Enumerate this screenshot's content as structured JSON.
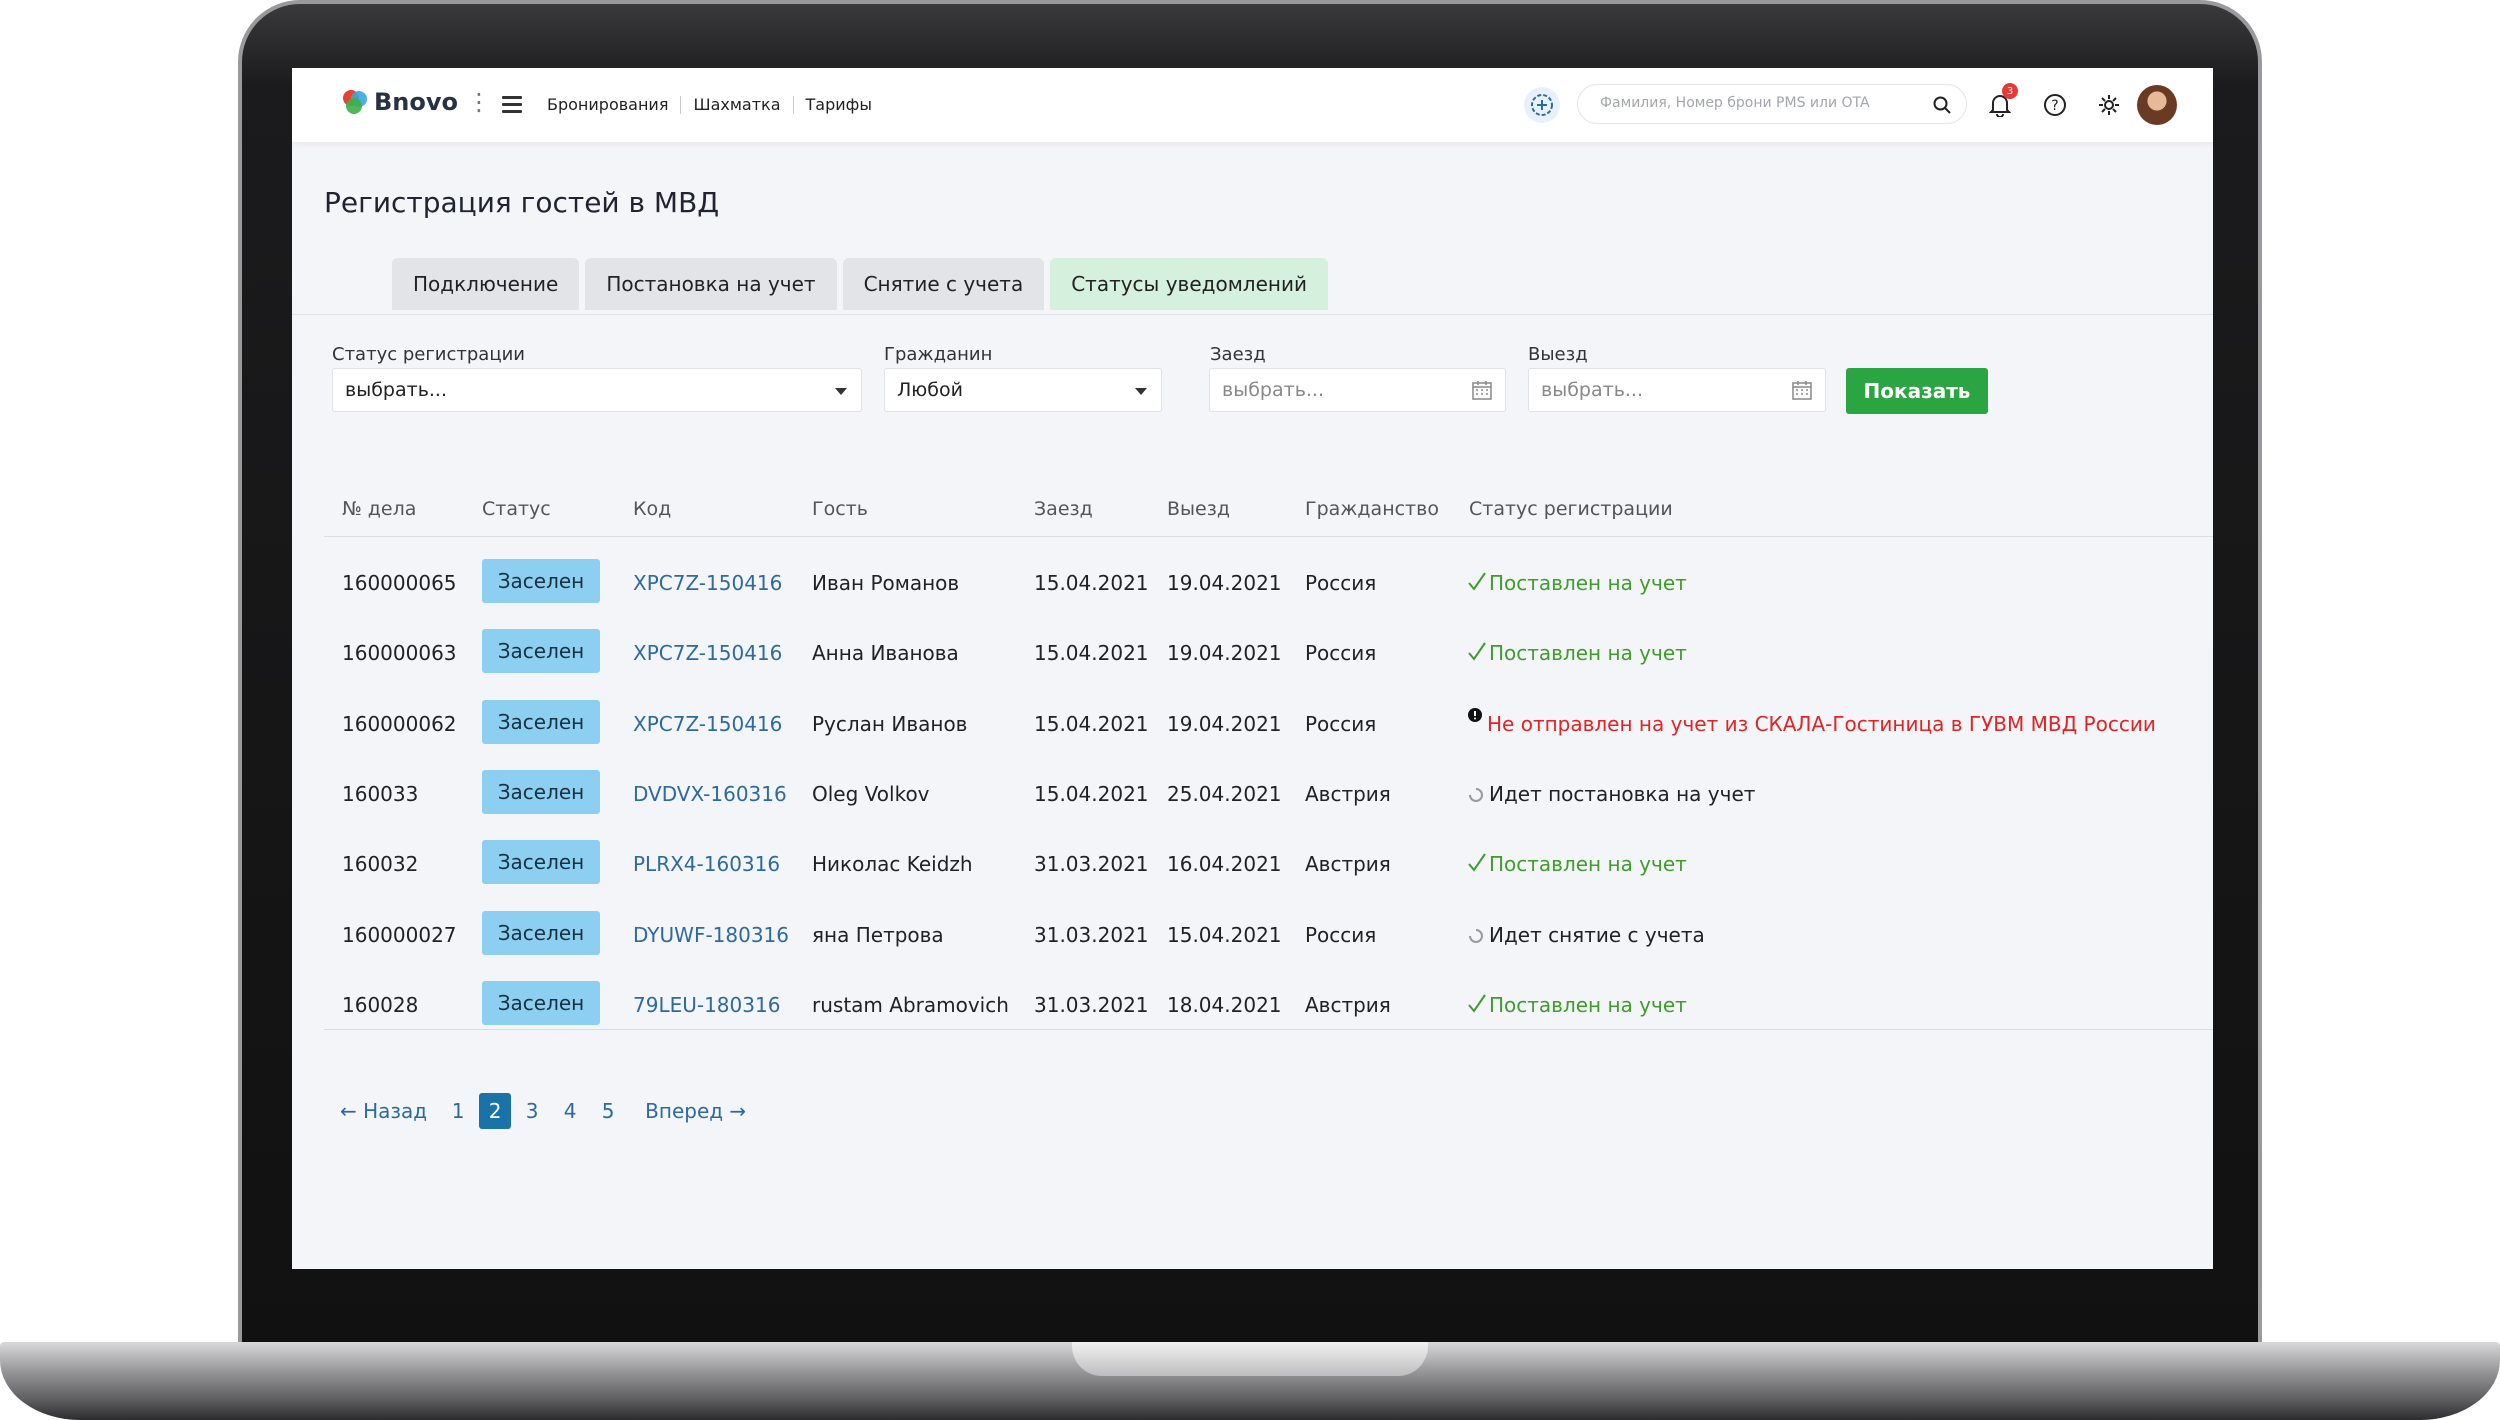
{
  "app": {
    "brand": "Bnovo",
    "nav": [
      "Бронирования",
      "Шахматка",
      "Тарифы"
    ],
    "search_placeholder": "Фамилия, Номер брони PMS или OTA",
    "notification_count": "3"
  },
  "page": {
    "title": "Регистрация гостей в МВД",
    "tabs": [
      "Подключение",
      "Постановка на учет",
      "Снятие с учета",
      "Статусы уведомлений"
    ],
    "active_tab": "Статусы уведомлений"
  },
  "filters": {
    "reg_status_label": "Статус регистрации",
    "reg_status_value": "выбрать...",
    "citizen_label": "Гражданин",
    "citizen_value": "Любой",
    "checkin_label": "Заезд",
    "checkin_placeholder": "выбрать...",
    "checkout_label": "Выезд",
    "checkout_placeholder": "выбрать...",
    "show_button": "Показать"
  },
  "table": {
    "headers": [
      "№ дела",
      "Статус",
      "Код",
      "Гость",
      "Заезд",
      "Выезд",
      "Гражданство",
      "Статус регистрации"
    ],
    "rows": [
      {
        "case": "160000065",
        "status": "Заселен",
        "code": "XPC7Z-150416",
        "guest": "Иван Романов",
        "in": "15.04.2021",
        "out": "19.04.2021",
        "citizenship": "Россия",
        "reg": "Поставлен на учет",
        "reg_kind": "ok"
      },
      {
        "case": "160000063",
        "status": "Заселен",
        "code": "XPC7Z-150416",
        "guest": "Анна Иванова",
        "in": "15.04.2021",
        "out": "19.04.2021",
        "citizenship": "Россия",
        "reg": "Поставлен на учет",
        "reg_kind": "ok"
      },
      {
        "case": "160000062",
        "status": "Заселен",
        "code": "XPC7Z-150416",
        "guest": "Руслан Иванов",
        "in": "15.04.2021",
        "out": "19.04.2021",
        "citizenship": "Россия",
        "reg": "Не отправлен на учет из СКАЛА-Гостиница в ГУВМ МВД России",
        "reg_kind": "error"
      },
      {
        "case": "160033",
        "status": "Заселен",
        "code": "DVDVX-160316",
        "guest": "Oleg Volkov",
        "in": "15.04.2021",
        "out": "25.04.2021",
        "citizenship": "Австрия",
        "reg": "Идет постановка на учет",
        "reg_kind": "progress"
      },
      {
        "case": "160032",
        "status": "Заселен",
        "code": "PLRX4-160316",
        "guest": "Николас Keidzh",
        "in": "31.03.2021",
        "out": "16.04.2021",
        "citizenship": "Австрия",
        "reg": "Поставлен на учет",
        "reg_kind": "ok"
      },
      {
        "case": "160000027",
        "status": "Заселен",
        "code": "DYUWF-180316",
        "guest": "яна Петрова",
        "in": "31.03.2021",
        "out": "15.04.2021",
        "citizenship": "Россия",
        "reg": "Идет снятие с учета",
        "reg_kind": "progress"
      },
      {
        "case": "160028",
        "status": "Заселен",
        "code": "79LEU-180316",
        "guest": "rustam Abramovich",
        "in": "31.03.2021",
        "out": "18.04.2021",
        "citizenship": "Австрия",
        "reg": "Поставлен на учет",
        "reg_kind": "ok"
      }
    ]
  },
  "pagination": {
    "prev": "← Назад",
    "pages": [
      "1",
      "2",
      "3",
      "4",
      "5"
    ],
    "current": "2",
    "next": "Вперед →"
  },
  "colors": {
    "accent_green": "#2aa541",
    "status_pill": "#8ccff0",
    "link_blue": "#2c6aa0",
    "ok_green": "#3f9d2c",
    "error_red": "#e02424"
  },
  "icons": [
    "hamburger-icon",
    "kebab-icon",
    "add-circle-icon",
    "search-icon",
    "bell-icon",
    "help-icon",
    "gear-icon",
    "calendar-icon",
    "check-icon",
    "alert-icon",
    "spinner-icon"
  ]
}
